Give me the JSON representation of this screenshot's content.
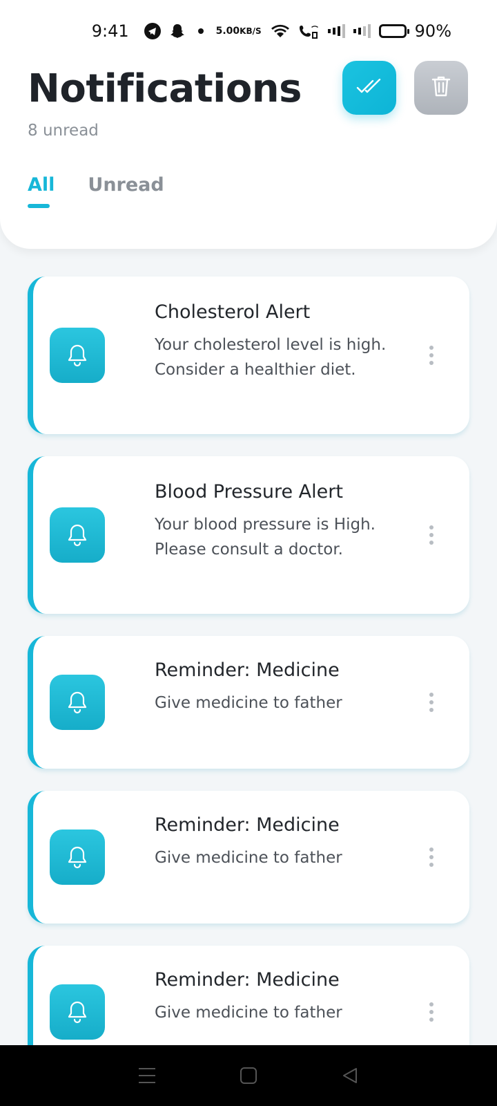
{
  "status_bar": {
    "time": "9:41",
    "speed_value": "5.00",
    "speed_unit": "KB/S",
    "battery": "90%"
  },
  "header": {
    "title": "Notifications",
    "unread_count": "8 unread",
    "mark_all_icon": "double-check-icon",
    "delete_icon": "trash-icon",
    "accent_color": "#17b7d8"
  },
  "tabs": [
    {
      "label": "All",
      "active": true
    },
    {
      "label": "Unread",
      "active": false
    }
  ],
  "notifications": [
    {
      "title": "Cholesterol Alert",
      "line1": "Your cholesterol level is high.",
      "line2": "Consider a healthier diet."
    },
    {
      "title": "Blood Pressure Alert",
      "line1": "Your blood pressure is High.",
      "line2": "Please consult a doctor."
    },
    {
      "title": "Reminder: Medicine",
      "line1": "Give medicine to father",
      "line2": ""
    },
    {
      "title": "Reminder: Medicine",
      "line1": "Give medicine to father",
      "line2": ""
    },
    {
      "title": "Reminder: Medicine",
      "line1": "Give medicine to father",
      "line2": ""
    }
  ],
  "nav_bar": {
    "icons": [
      "menu-icon",
      "home-icon",
      "back-icon"
    ]
  }
}
